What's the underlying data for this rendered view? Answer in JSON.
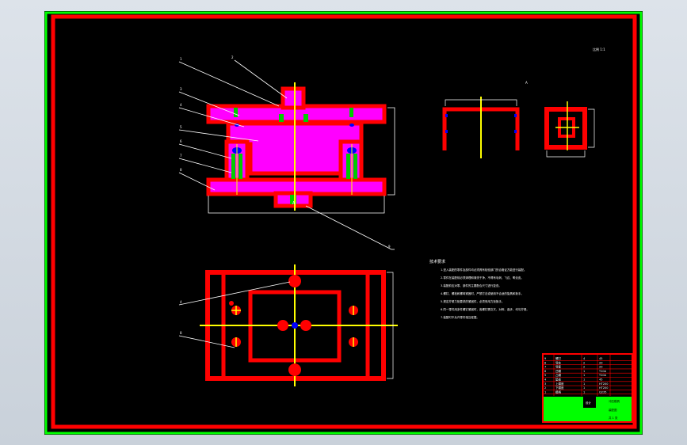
{
  "drawing": {
    "callouts_top": [
      "1",
      "2",
      "3",
      "4",
      "5",
      "6",
      "7",
      "8"
    ],
    "callout_right": "9",
    "callouts_bottom": [
      "4",
      "8"
    ],
    "detail_mark": "A",
    "center_mark": "A",
    "scale_note": "比例 1:1",
    "tech_title": "技术要求",
    "tech_lines": [
      "1.进入装配的零件及部件均必须具有检验部门的合格证方能进行装配。",
      "2.零件在装配前必须清理和清洗干净，不得有毛刺、飞边、氧化皮。",
      "3.装配前应对零、部件的主要配合尺寸进行复查。",
      "4.螺钉、螺栓和螺母紧固时，严禁打击或使用不合适的旋具和扳手。",
      "5.规定拧紧力矩要求的紧固件，必须采用力矩扳手。",
      "6.同一零件用多件螺钉紧固时，各螺钉需交叉、对称、逐步、均匀拧紧。",
      "7.装配时不允许零件相互碰撞。"
    ]
  },
  "title_block": {
    "rows": [
      [
        "9",
        "螺钉",
        "4",
        "45"
      ],
      [
        "8",
        "导柱",
        "2",
        "20"
      ],
      [
        "7",
        "导套",
        "2",
        "20"
      ],
      [
        "6",
        "凹模",
        "1",
        "T10A"
      ],
      [
        "5",
        "凸模",
        "1",
        "T10A"
      ],
      [
        "4",
        "垫板",
        "1",
        "45"
      ],
      [
        "3",
        "上模座",
        "1",
        "HT200"
      ],
      [
        "2",
        "下模座",
        "1",
        "HT200"
      ],
      [
        "1",
        "模柄",
        "1",
        "Q235"
      ]
    ],
    "drawing_name": "冲压模具",
    "assembly_label": "装配图",
    "sheet_note": "共 1 张",
    "school": "设计"
  },
  "colors": {
    "sheet": "#000000",
    "outer_border": "#ff0000",
    "inner_border": "#00ff00",
    "part_fill": "#ff00ff",
    "part_outline": "#ff0000",
    "centerline": "#ffff00",
    "bolt": "#00cc00",
    "hole": "#0000ff",
    "leader": "#ffffff"
  }
}
